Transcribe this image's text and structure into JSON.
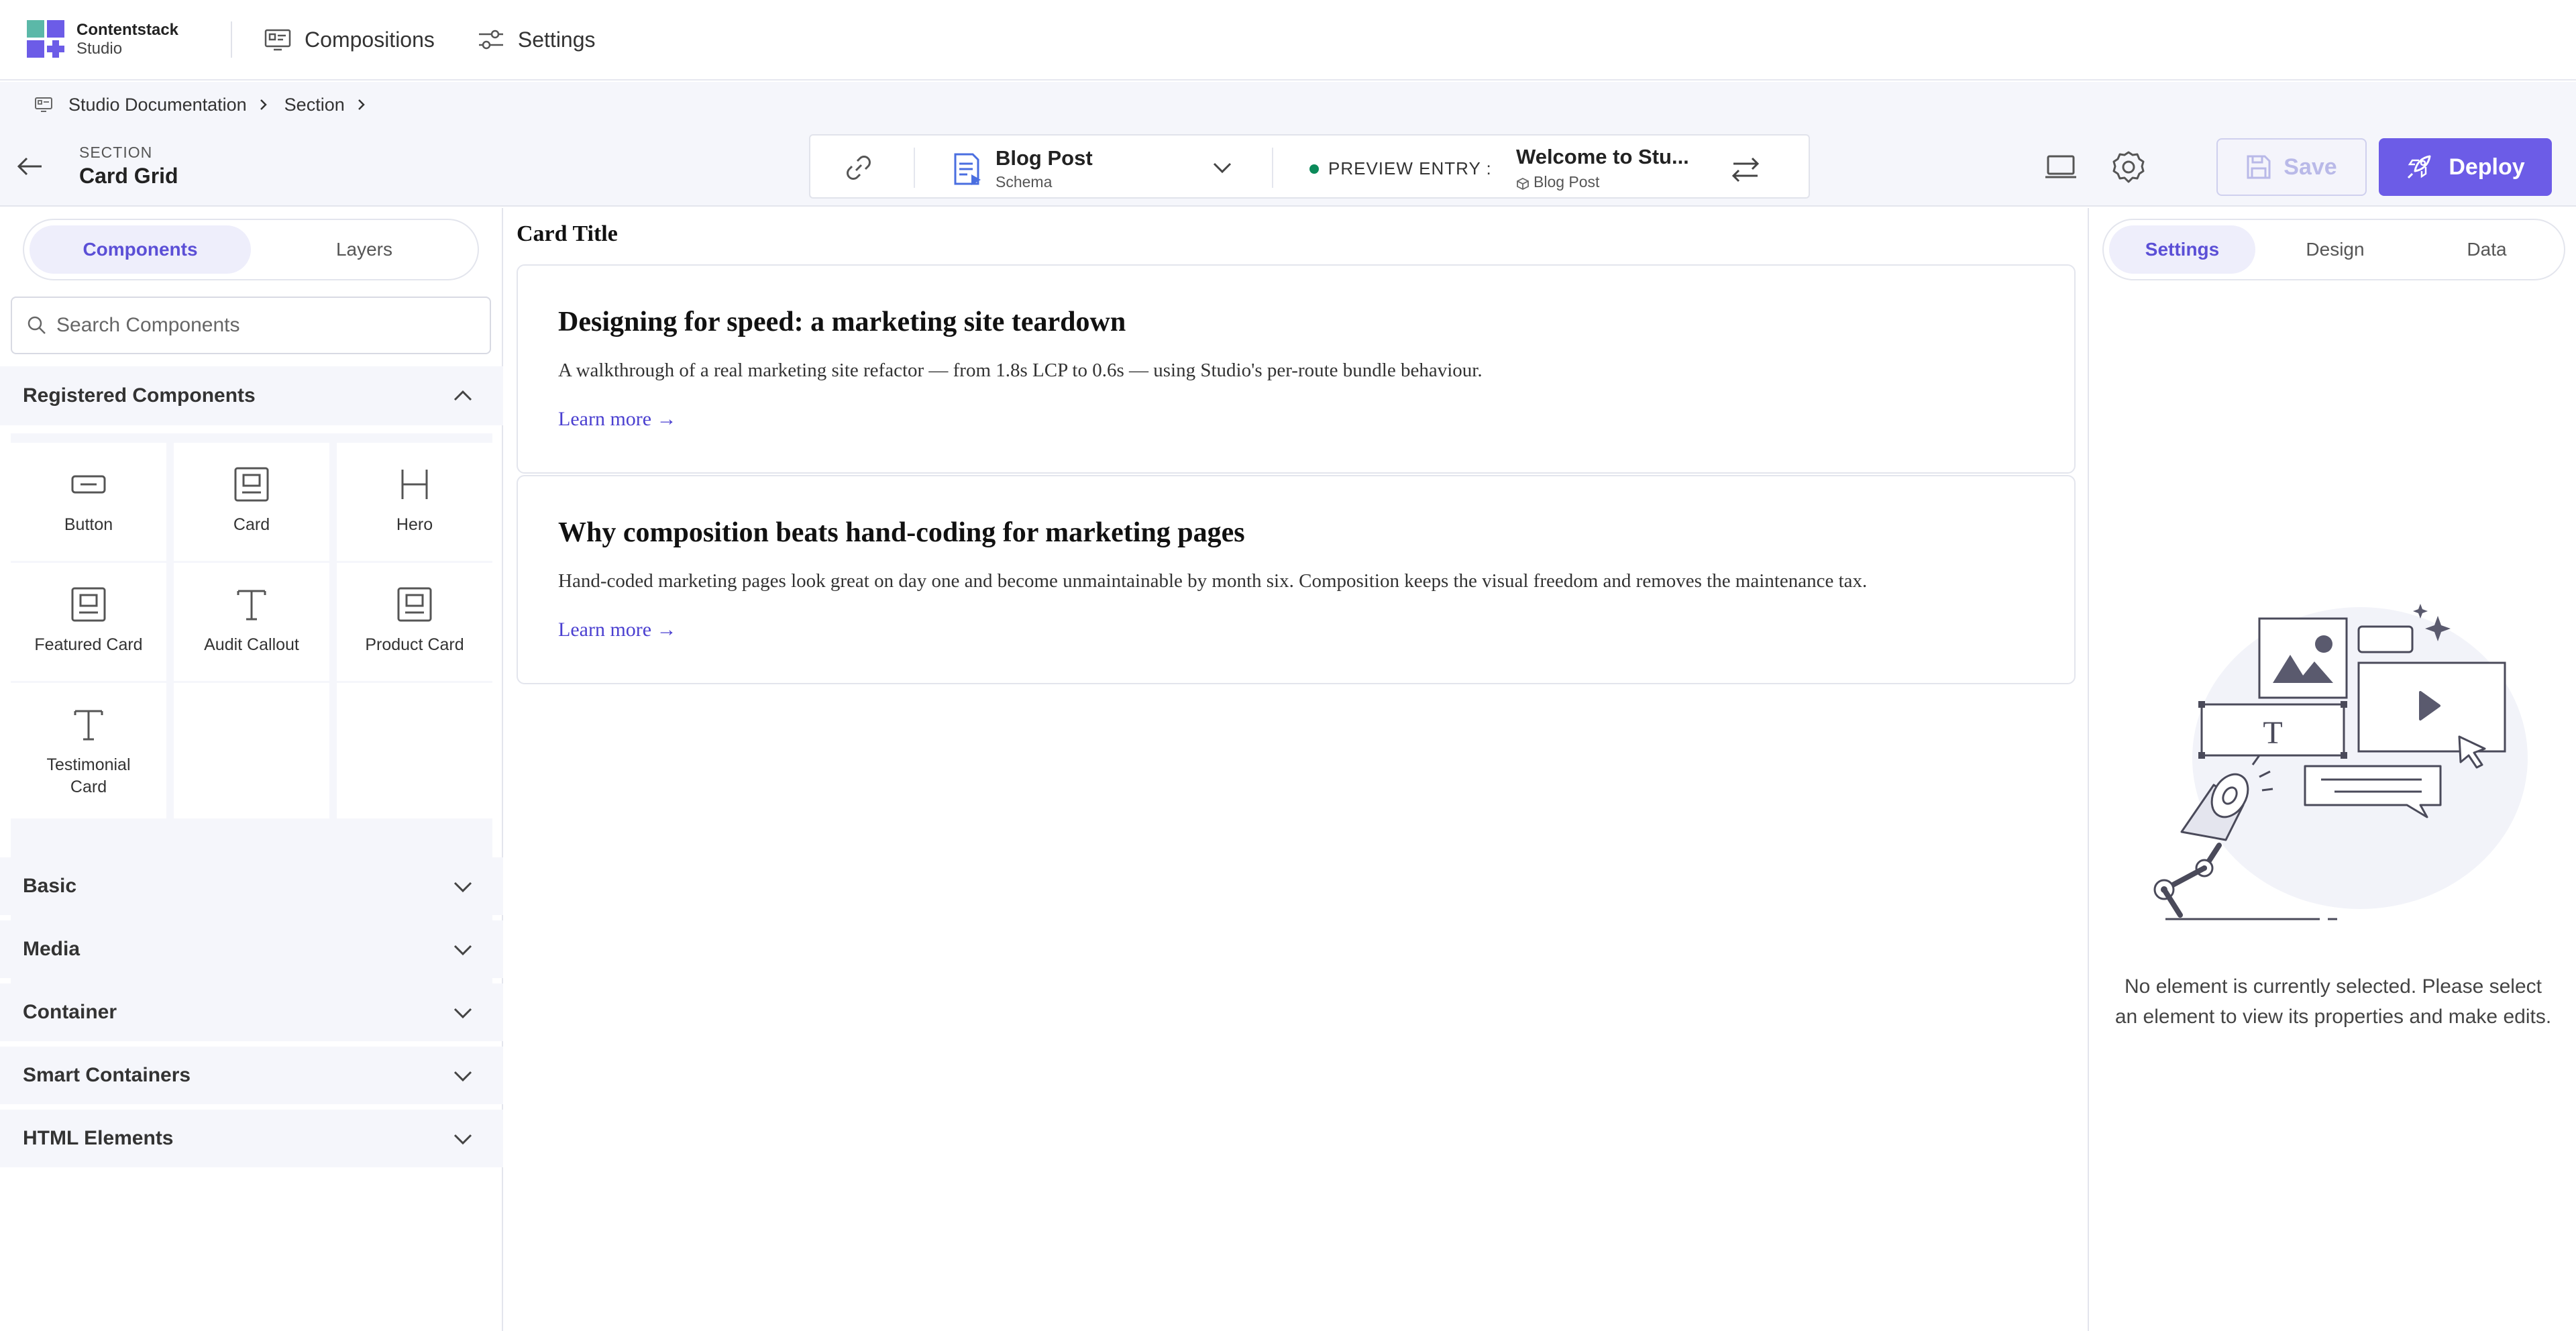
{
  "app": {
    "brand_name": "Contentstack",
    "brand_sub": "Studio",
    "nav": [
      {
        "label": "Compositions",
        "icon": "compositions-icon"
      },
      {
        "label": "Settings",
        "icon": "sliders-icon"
      }
    ]
  },
  "breadcrumb": {
    "items": [
      "Studio Documentation",
      "Section"
    ]
  },
  "toolbar": {
    "section_label": "SECTION",
    "section_name": "Card Grid",
    "schema_title": "Blog Post",
    "schema_sub": "Schema",
    "preview_label": "PREVIEW ENTRY :",
    "entry_title": "Welcome to Stu...",
    "entry_sub": "Blog Post",
    "save_label": "Save",
    "deploy_label": "Deploy",
    "status_color": "#0b8a5a",
    "accent_color": "#6c5ce7"
  },
  "left": {
    "tabs": [
      "Components",
      "Layers"
    ],
    "active_tab": "Components",
    "search_placeholder": "Search Components",
    "registered_title": "Registered Components",
    "components": [
      {
        "label": "Button",
        "icon": "button-icon"
      },
      {
        "label": "Card",
        "icon": "card-icon"
      },
      {
        "label": "Hero",
        "icon": "hero-icon"
      },
      {
        "label": "Featured Card",
        "icon": "card-icon"
      },
      {
        "label": "Audit Callout",
        "icon": "text-icon"
      },
      {
        "label": "Product Card",
        "icon": "card-icon"
      },
      {
        "label": "Testimonial Card",
        "icon": "text-icon"
      }
    ],
    "sections": [
      "Basic",
      "Media",
      "Container",
      "Smart Containers",
      "HTML Elements"
    ]
  },
  "canvas": {
    "title": "Card Title",
    "cards": [
      {
        "title": "Designing for speed: a marketing site teardown",
        "body": "A walkthrough of a real marketing site refactor — from 1.8s LCP to 0.6s — using Studio's per-route bundle behaviour.",
        "link": "Learn more →"
      },
      {
        "title": "Why composition beats hand-coding for marketing pages",
        "body": "Hand-coded marketing pages look great on day one and become unmaintainable by month six. Composition keeps the visual freedom and removes the maintenance tax.",
        "link": "Learn more →"
      }
    ]
  },
  "right": {
    "tabs": [
      "Settings",
      "Design",
      "Data"
    ],
    "active_tab": "Settings",
    "empty_message": "No element is currently selected. Please select an element to view its properties and make edits."
  }
}
